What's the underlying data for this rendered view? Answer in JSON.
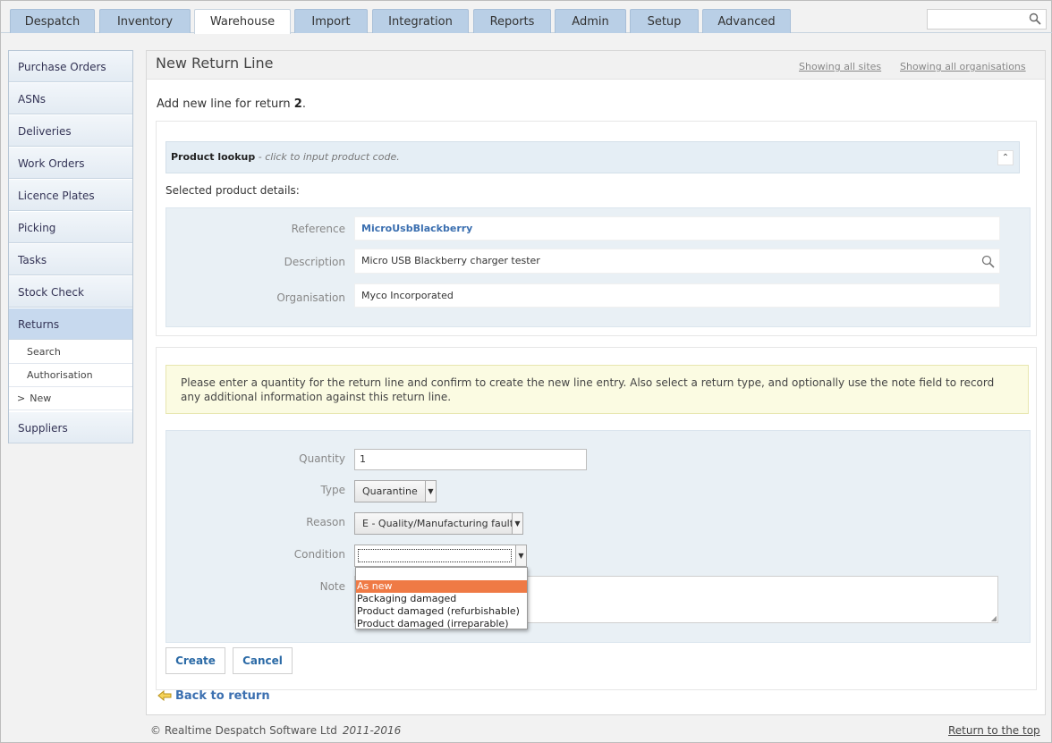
{
  "nav": {
    "tabs": [
      "Despatch",
      "Inventory",
      "Warehouse",
      "Import",
      "Integration",
      "Reports",
      "Admin",
      "Setup",
      "Advanced"
    ],
    "active_tab": "Warehouse",
    "search_value": ""
  },
  "sidebar": {
    "items": [
      "Purchase Orders",
      "ASNs",
      "Deliveries",
      "Work Orders",
      "Licence Plates",
      "Picking",
      "Tasks",
      "Stock Check",
      "Returns"
    ],
    "sub_items": [
      "Search",
      "Authorisation",
      "New"
    ],
    "sub_marker": ">",
    "last_item": "Suppliers"
  },
  "header": {
    "title": "New Return Line",
    "sites_link": "Showing all sites",
    "orgs_link": "Showing all organisations"
  },
  "intro": {
    "text": "Add new line for return ",
    "return_number": "2",
    "suffix": "."
  },
  "lookup": {
    "label": "Product lookup",
    "hint": " - click to input product code.",
    "collapse_glyph": "⌃"
  },
  "selected": {
    "heading": "Selected product details:",
    "reference_label": "Reference",
    "reference_value": "MicroUsbBlackberry",
    "description_label": "Description",
    "description_value": "Micro USB Blackberry charger tester",
    "organisation_label": "Organisation",
    "organisation_value": "Myco Incorporated"
  },
  "notice": "Please enter a quantity for the return line and confirm to create the new line entry. Also select a return type, and optionally use the note field to record any additional information against this return line.",
  "form": {
    "quantity_label": "Quantity",
    "quantity_value": "1",
    "type_label": "Type",
    "type_value": "Quarantine",
    "reason_label": "Reason",
    "reason_value": "E - Quality/Manufacturing fault",
    "condition_label": "Condition",
    "condition_value": "",
    "note_label": "Note",
    "note_value": "",
    "condition_options": [
      "",
      "As new",
      "Packaging damaged",
      "Product damaged (refurbishable)",
      "Product damaged (irreparable)"
    ],
    "condition_highlighted": "As new"
  },
  "actions": {
    "create": "Create",
    "cancel": "Cancel",
    "back": "Back to return"
  },
  "footer": {
    "copyright": "© Realtime Despatch Software Ltd",
    "years": "2011-2016",
    "top_link": "Return to the top"
  },
  "colors": {
    "tab_bg": "#b9cfe6",
    "link_blue": "#3b6fb0",
    "highlight_orange": "#ef7a45",
    "panel_bg": "#e9f0f5",
    "notice_bg": "#fbfbe2"
  }
}
